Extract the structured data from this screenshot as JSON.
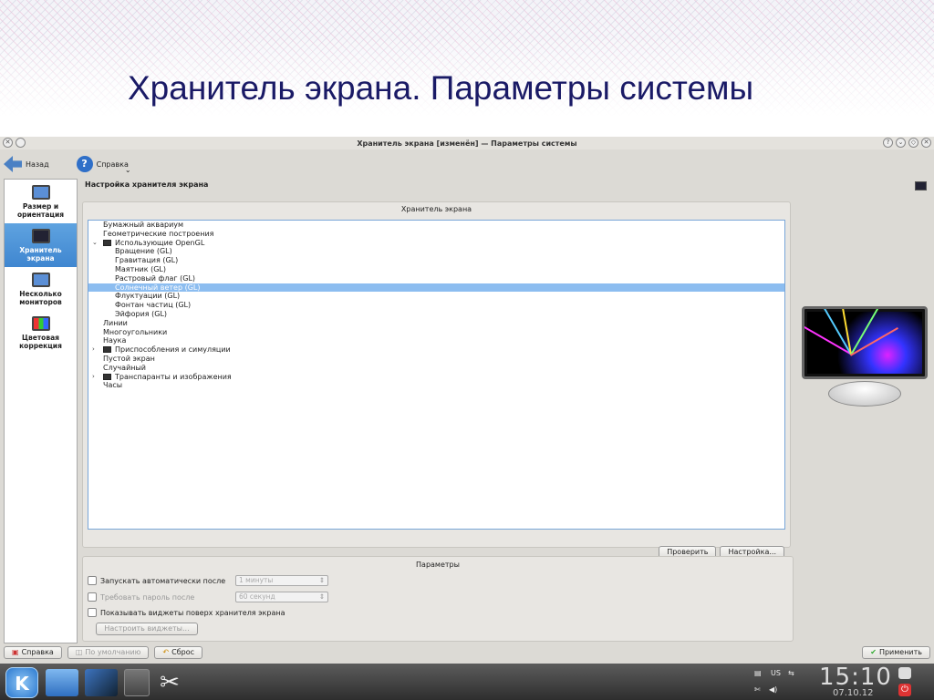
{
  "slide": {
    "title": "Хранитель экрана. Параметры системы"
  },
  "window": {
    "title": "Хранитель экрана [изменён] — Параметры системы"
  },
  "toolbar": {
    "back": "Назад",
    "help": "Справка"
  },
  "sidebar": {
    "items": [
      {
        "label": "Размер и ориентация"
      },
      {
        "label": "Хранитель экрана"
      },
      {
        "label": "Несколько мониторов"
      },
      {
        "label": "Цветовая коррекция"
      }
    ]
  },
  "content": {
    "title": "Настройка хранителя экрана",
    "group_title": "Хранитель экрана"
  },
  "tree": {
    "items": [
      {
        "label": "Бумажный аквариум"
      },
      {
        "label": "Геометрические построения"
      },
      {
        "label": "Использующие OpenGL"
      },
      {
        "label": "Вращение (GL)"
      },
      {
        "label": "Гравитация (GL)"
      },
      {
        "label": "Маятник (GL)"
      },
      {
        "label": "Растровый флаг (GL)"
      },
      {
        "label": "Солнечный ветер (GL)"
      },
      {
        "label": "Флуктуации (GL)"
      },
      {
        "label": "Фонтан частиц (GL)"
      },
      {
        "label": "Эйфория (GL)"
      },
      {
        "label": "Линии"
      },
      {
        "label": "Многоугольники"
      },
      {
        "label": "Наука"
      },
      {
        "label": "Приспособления и симуляции"
      },
      {
        "label": "Пустой экран"
      },
      {
        "label": "Случайный"
      },
      {
        "label": "Транспаранты и изображения"
      },
      {
        "label": "Часы"
      }
    ]
  },
  "buttons": {
    "test": "Проверить",
    "setup": "Настройка..."
  },
  "params": {
    "title": "Параметры",
    "autostart": "Запускать автоматически после",
    "autostart_value": "1 минуты",
    "password": "Требовать пароль после",
    "password_value": "60 секунд",
    "widgets": "Показывать виджеты поверх хранителя экрана",
    "widgets_btn": "Настроить виджеты..."
  },
  "bottom": {
    "help": "Справка",
    "defaults": "По умолчанию",
    "reset": "Сброс",
    "apply": "Применить"
  },
  "panel": {
    "time": "15:10",
    "date": "07.10.12",
    "layout": "US"
  }
}
